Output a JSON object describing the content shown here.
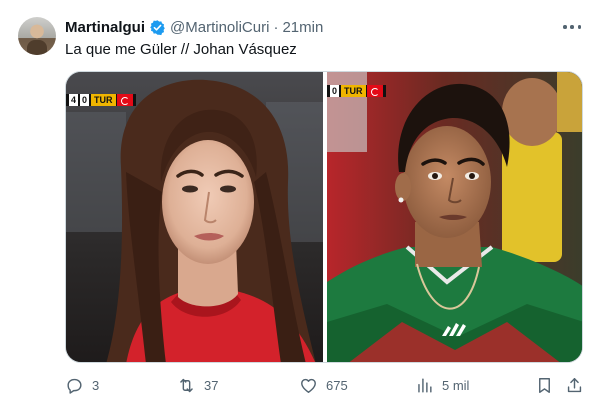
{
  "tweet": {
    "author_name": "Martinalgui",
    "handle": "@MartinoliCuri",
    "separator": "·",
    "time": "21min",
    "text": "La que me Güler // Johan Vásquez"
  },
  "media": {
    "left_scorebug": {
      "score": "4",
      "score2": "0",
      "team": "TUR"
    },
    "right_scorebug": {
      "score": "0",
      "team": "TUR"
    }
  },
  "actions": {
    "replies": "3",
    "reposts": "37",
    "likes": "675",
    "views": "5 mil"
  },
  "icons": {
    "verified": "verified-badge-icon",
    "more": "more-icon",
    "reply": "reply-icon",
    "repost": "repost-icon",
    "like": "heart-icon",
    "views": "views-icon",
    "bookmark": "bookmark-icon",
    "share": "share-icon"
  },
  "colors": {
    "verified_blue": "#1d9bf0",
    "secondary_text": "#536471",
    "turkey_red": "#e30a17"
  }
}
